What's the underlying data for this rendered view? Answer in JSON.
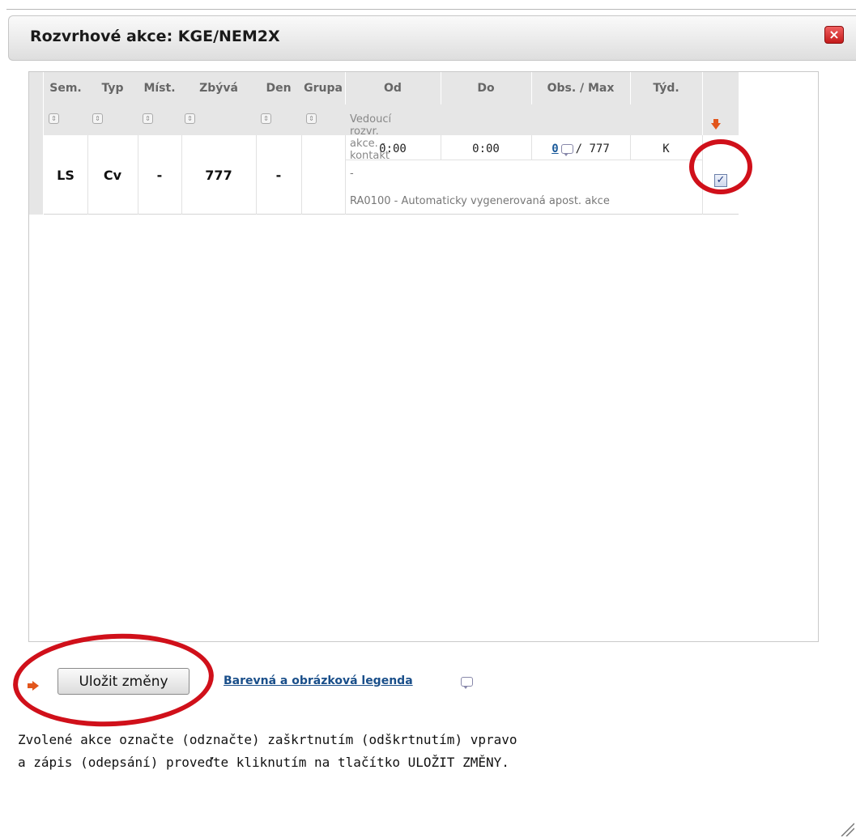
{
  "dialog": {
    "title": "Rozvrhové akce: KGE/NEM2X",
    "close_symbol": "×",
    "close_icon": "close-icon"
  },
  "table": {
    "headers": [
      "Sem.",
      "Typ",
      "Míst.",
      "Zbývá",
      "Den",
      "Grupa",
      "Od",
      "Do",
      "Obs. / Max",
      "Týd."
    ],
    "contact_label": "Vedoucí rozvr. akce. - kontakt",
    "sort_icon": "sort-icon",
    "rows": [
      {
        "sem": "LS",
        "typ": "Cv",
        "mist": "-",
        "zbyva": "777",
        "den": "-",
        "grupa": "",
        "od": "0:00",
        "do": "0:00",
        "obs": "0",
        "max": "/ 777",
        "tyd": "K",
        "vedouci": "-",
        "note": "RA0100 - Automaticky vygenerovaná apost. akce",
        "checked": true
      }
    ],
    "checkmark": "✓"
  },
  "footer": {
    "save_label": "Uložit změny",
    "legend_link": "Barevná a obrázková legenda",
    "help_line_1": "Zvolené akce označte (odznačte) zaškrtnutím (odškrtnutím) vpravo",
    "help_line_2": "a zápis (odepsání) proveďte kliknutím na tlačítko ULOŽIT ZMĚNY."
  },
  "colors": {
    "annotation_red": "#d0101a",
    "accent_orange": "#e2561c",
    "link_blue": "#1a4f8a"
  }
}
